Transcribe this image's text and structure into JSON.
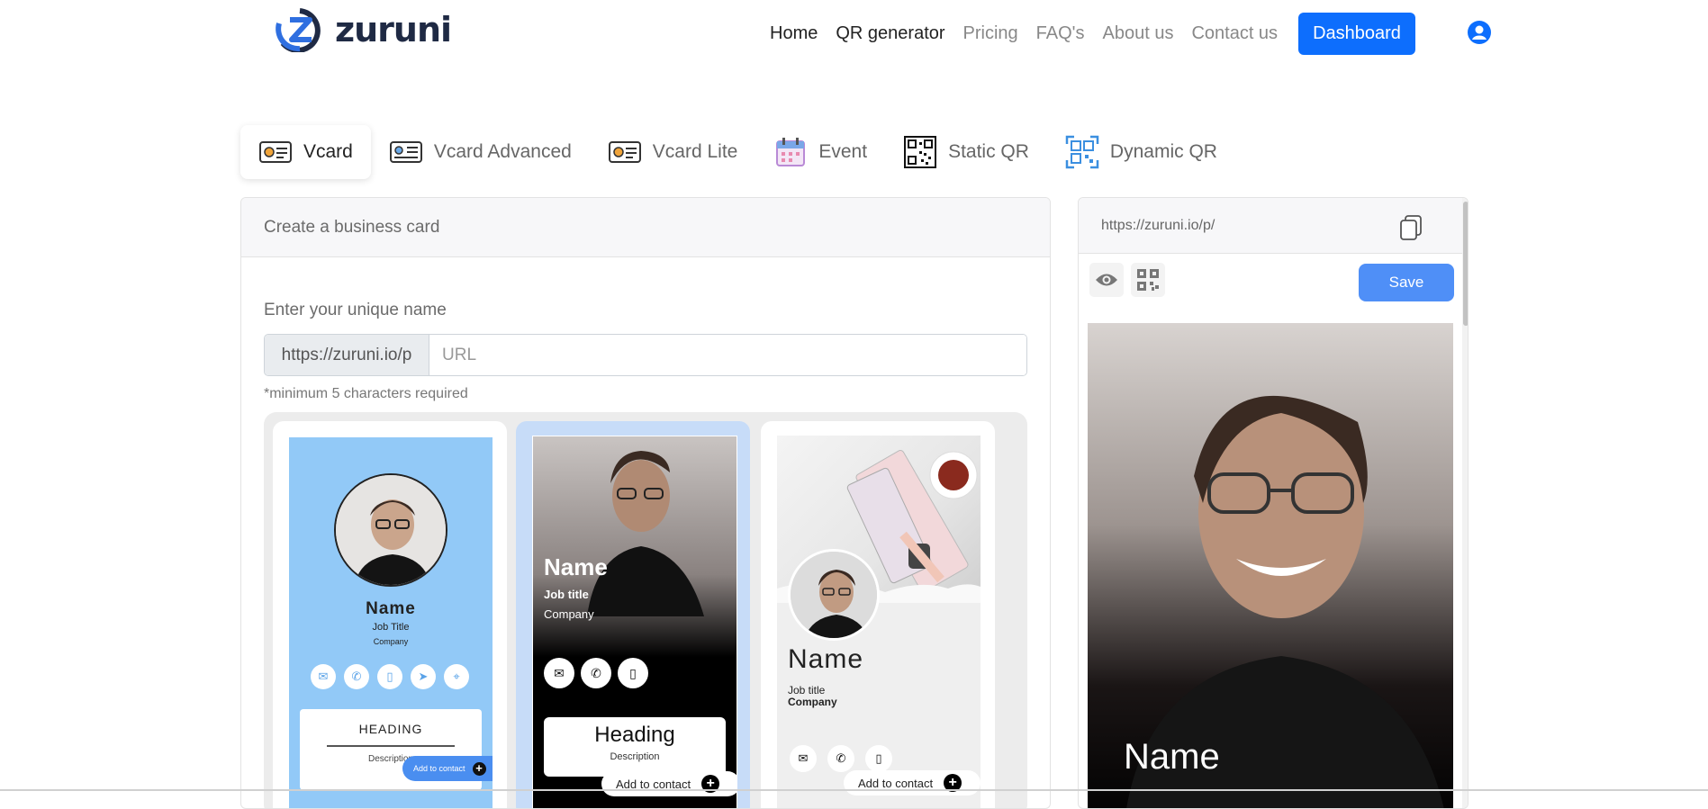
{
  "brand": {
    "name": "zuruni"
  },
  "nav": {
    "items": [
      "Home",
      "QR generator",
      "Pricing",
      "FAQ's",
      "About us",
      "Contact us"
    ],
    "dashboard_label": "Dashboard"
  },
  "tabs": [
    {
      "label": "Vcard",
      "icon": "vcard-icon",
      "active": true
    },
    {
      "label": "Vcard Advanced",
      "icon": "vcard-advanced-icon",
      "active": false
    },
    {
      "label": "Vcard Lite",
      "icon": "vcard-lite-icon",
      "active": false
    },
    {
      "label": "Event",
      "icon": "calendar-icon",
      "active": false
    },
    {
      "label": "Static QR",
      "icon": "qr-code-icon",
      "active": false
    },
    {
      "label": "Dynamic QR",
      "icon": "dynamic-qr-icon",
      "active": false
    }
  ],
  "form": {
    "card_title": "Create a business card",
    "unique_name_label": "Enter your unique name",
    "url_prefix": "https://zuruni.io/p",
    "url_placeholder": "URL",
    "url_value": "",
    "min_note": "*minimum 5 characters required"
  },
  "templates": [
    {
      "name": "Name",
      "job": "Job Title",
      "company": "Company",
      "heading": "HEADING",
      "description": "Description",
      "add_contact": "Add to contact"
    },
    {
      "name": "Name",
      "job": "Job title",
      "company": "Company",
      "heading": "Heading",
      "description": "Description",
      "add_contact": "Add to contact",
      "selected": true
    },
    {
      "name": "Name",
      "job": "Job title",
      "company": "Company",
      "add_contact": "Add to contact"
    }
  ],
  "preview": {
    "url": "https://zuruni.io/p/",
    "save_label": "Save",
    "name": "Name"
  },
  "colors": {
    "primary": "#0d6efd",
    "save": "#4f8ff7",
    "template1_bg": "#92c9f7",
    "template_selected_bg": "#c7dcf8"
  }
}
